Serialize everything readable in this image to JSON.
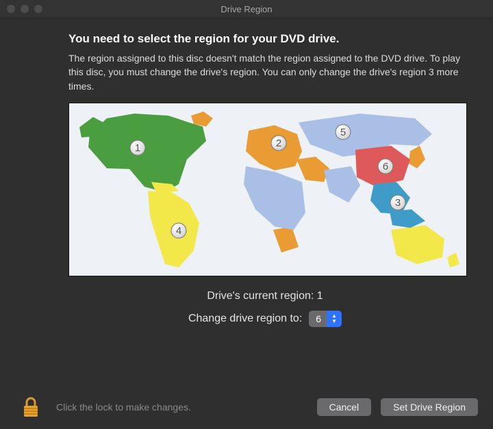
{
  "window_title": "Drive Region",
  "heading": "You need to select the region for your DVD drive.",
  "description": "The region assigned to this disc doesn't match the region assigned to the DVD drive. To play this disc, you must change the drive's region. You can only change the drive's region 3 more times.",
  "current_region_label": "Drive's current region: 1",
  "change_label": "Change drive region to:",
  "selected_region": "6",
  "lock_hint": "Click the lock to make changes.",
  "cancel_label": "Cancel",
  "confirm_label": "Set Drive Region",
  "map": {
    "regions": [
      {
        "id": 1,
        "label": "1",
        "color": "#4a9e3f"
      },
      {
        "id": 2,
        "label": "2",
        "color": "#e99b34"
      },
      {
        "id": 3,
        "label": "3",
        "color": "#3f9cc8"
      },
      {
        "id": 4,
        "label": "4",
        "color": "#f2e84a"
      },
      {
        "id": 5,
        "label": "5",
        "color": "#a9bfe6"
      },
      {
        "id": 6,
        "label": "6",
        "color": "#de5a5a"
      }
    ]
  }
}
